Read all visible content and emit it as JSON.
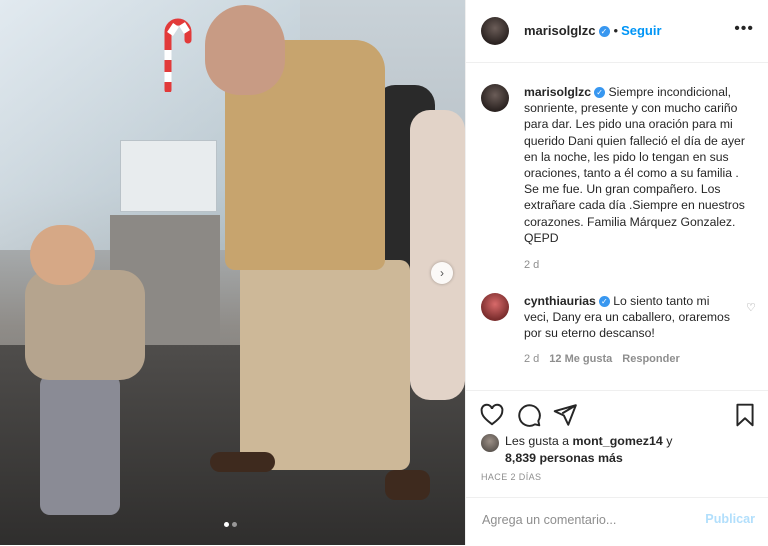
{
  "author": {
    "username": "marisolglzc",
    "follow_label": "Seguir"
  },
  "caption": {
    "username": "marisolglzc",
    "text": "Siempre incondicional, sonriente, presente y con mucho cariño para dar. Les pido una oración para mi querido Dani quien falleció el día de ayer en la noche, les pido lo tengan en sus oraciones, tanto a él como a su familia . Se me fue. Un gran compañero. Los extrañare cada día .Siempre en nuestros corazones. Familia Márquez Gonzalez. QEPD",
    "time": "2 d"
  },
  "comment": {
    "username": "cynthiaurias",
    "text": "Lo siento tanto mi veci, Dany era un caballero, oraremos por su eterno descanso!",
    "time": "2 d",
    "likes": "12 Me gusta",
    "reply_label": "Responder"
  },
  "likes": {
    "prefix": "Les gusta a",
    "user": "mont_gomez14",
    "connector": "y",
    "count": "8,839 personas más"
  },
  "date": "HACE 2 DÍAS",
  "add_comment": {
    "placeholder": "Agrega un comentario...",
    "publish_label": "Publicar"
  },
  "carousel": {
    "total": 2,
    "active": 1
  },
  "icons": {
    "verified": "verified-badge",
    "more": "more-icon",
    "next": "chevron-right-icon",
    "heart": "heart-icon",
    "comment": "comment-icon",
    "share": "share-icon",
    "save": "bookmark-icon"
  },
  "colors": {
    "link": "#0095f6",
    "verified": "#3897f0",
    "muted": "#8e8e8e",
    "publish_disabled": "#b2dffc"
  }
}
